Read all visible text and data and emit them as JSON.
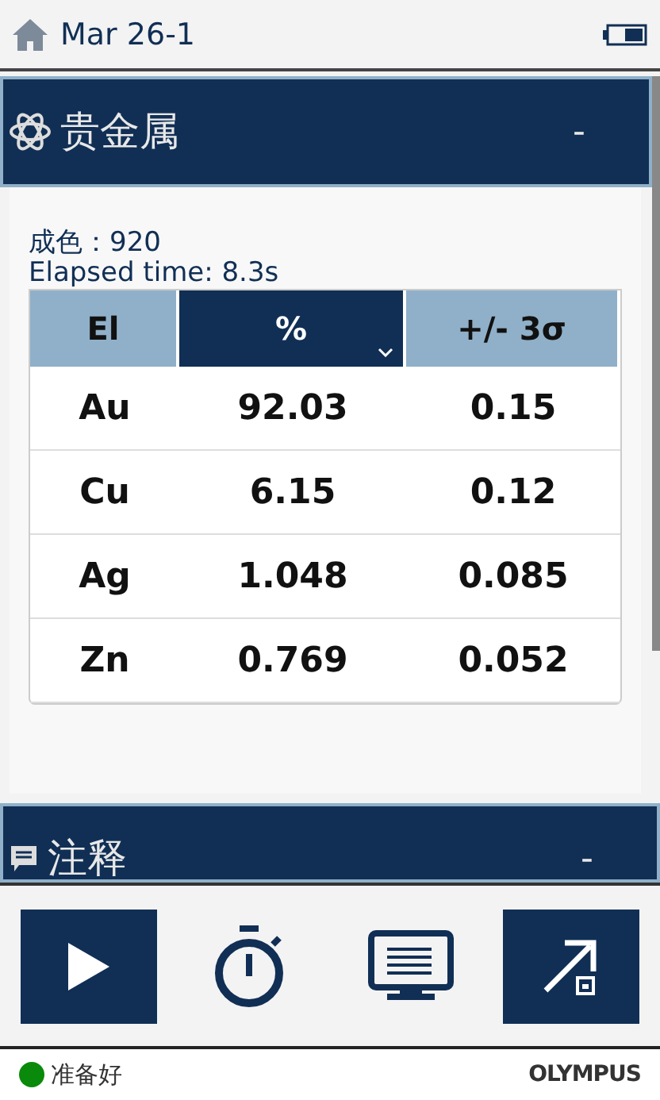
{
  "header": {
    "title": "Mar 26-1"
  },
  "results_section": {
    "title": "贵金属",
    "collapse": "-",
    "grade": "成色：920",
    "elapsed": "Elapsed time: 8.3s",
    "table": {
      "columns": [
        {
          "label": "El",
          "selected": false
        },
        {
          "label": "%",
          "selected": true
        },
        {
          "label": "+/- 3σ",
          "selected": false
        }
      ],
      "rows": [
        [
          "Au",
          "92.03",
          "0.15"
        ],
        [
          "Cu",
          "6.15",
          "0.12"
        ],
        [
          "Ag",
          "1.048",
          "0.085"
        ],
        [
          "Zn",
          "0.769",
          "0.052"
        ]
      ]
    }
  },
  "notes_section": {
    "title": "注释",
    "collapse": "-"
  },
  "toolbar": [
    {
      "kind": "play",
      "filled": true
    },
    {
      "kind": "timer",
      "filled": false
    },
    {
      "kind": "display",
      "filled": false
    },
    {
      "kind": "export",
      "filled": true
    }
  ],
  "status_bar": {
    "status": "准备好",
    "color": "#0a8a0a",
    "brand": "OLYMPUS"
  }
}
